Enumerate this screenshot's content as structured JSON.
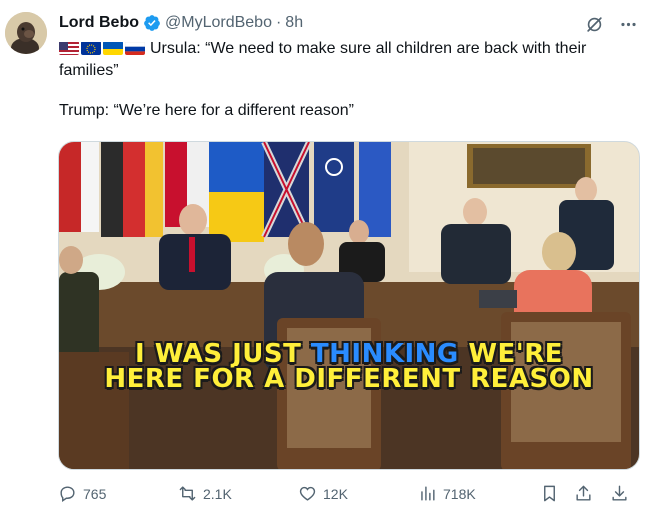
{
  "author": {
    "name": "Lord Bebo",
    "handle": "@MyLordBebo",
    "time": "8h"
  },
  "tweet": {
    "flags": [
      "us-flag",
      "eu-flag",
      "ukraine-flag",
      "russia-flag"
    ],
    "line1": "Ursula: “We need to make sure all children are back with their families”",
    "line2": "Trump: “We’re here for a different reason”"
  },
  "media": {
    "caption_line1_a": "I WAS JUST ",
    "caption_line1_b": "THINKING",
    "caption_line1_c": " WE'RE",
    "caption_line2": "HERE FOR A DIFFERENT REASON"
  },
  "actions": {
    "replies": "765",
    "reposts": "2.1K",
    "likes": "12K",
    "views": "718K"
  },
  "colors": {
    "verified": "#1d9bf0",
    "text_secondary": "#536471",
    "caption_yellow": "#ffef3a",
    "caption_blue": "#2a8cff"
  }
}
